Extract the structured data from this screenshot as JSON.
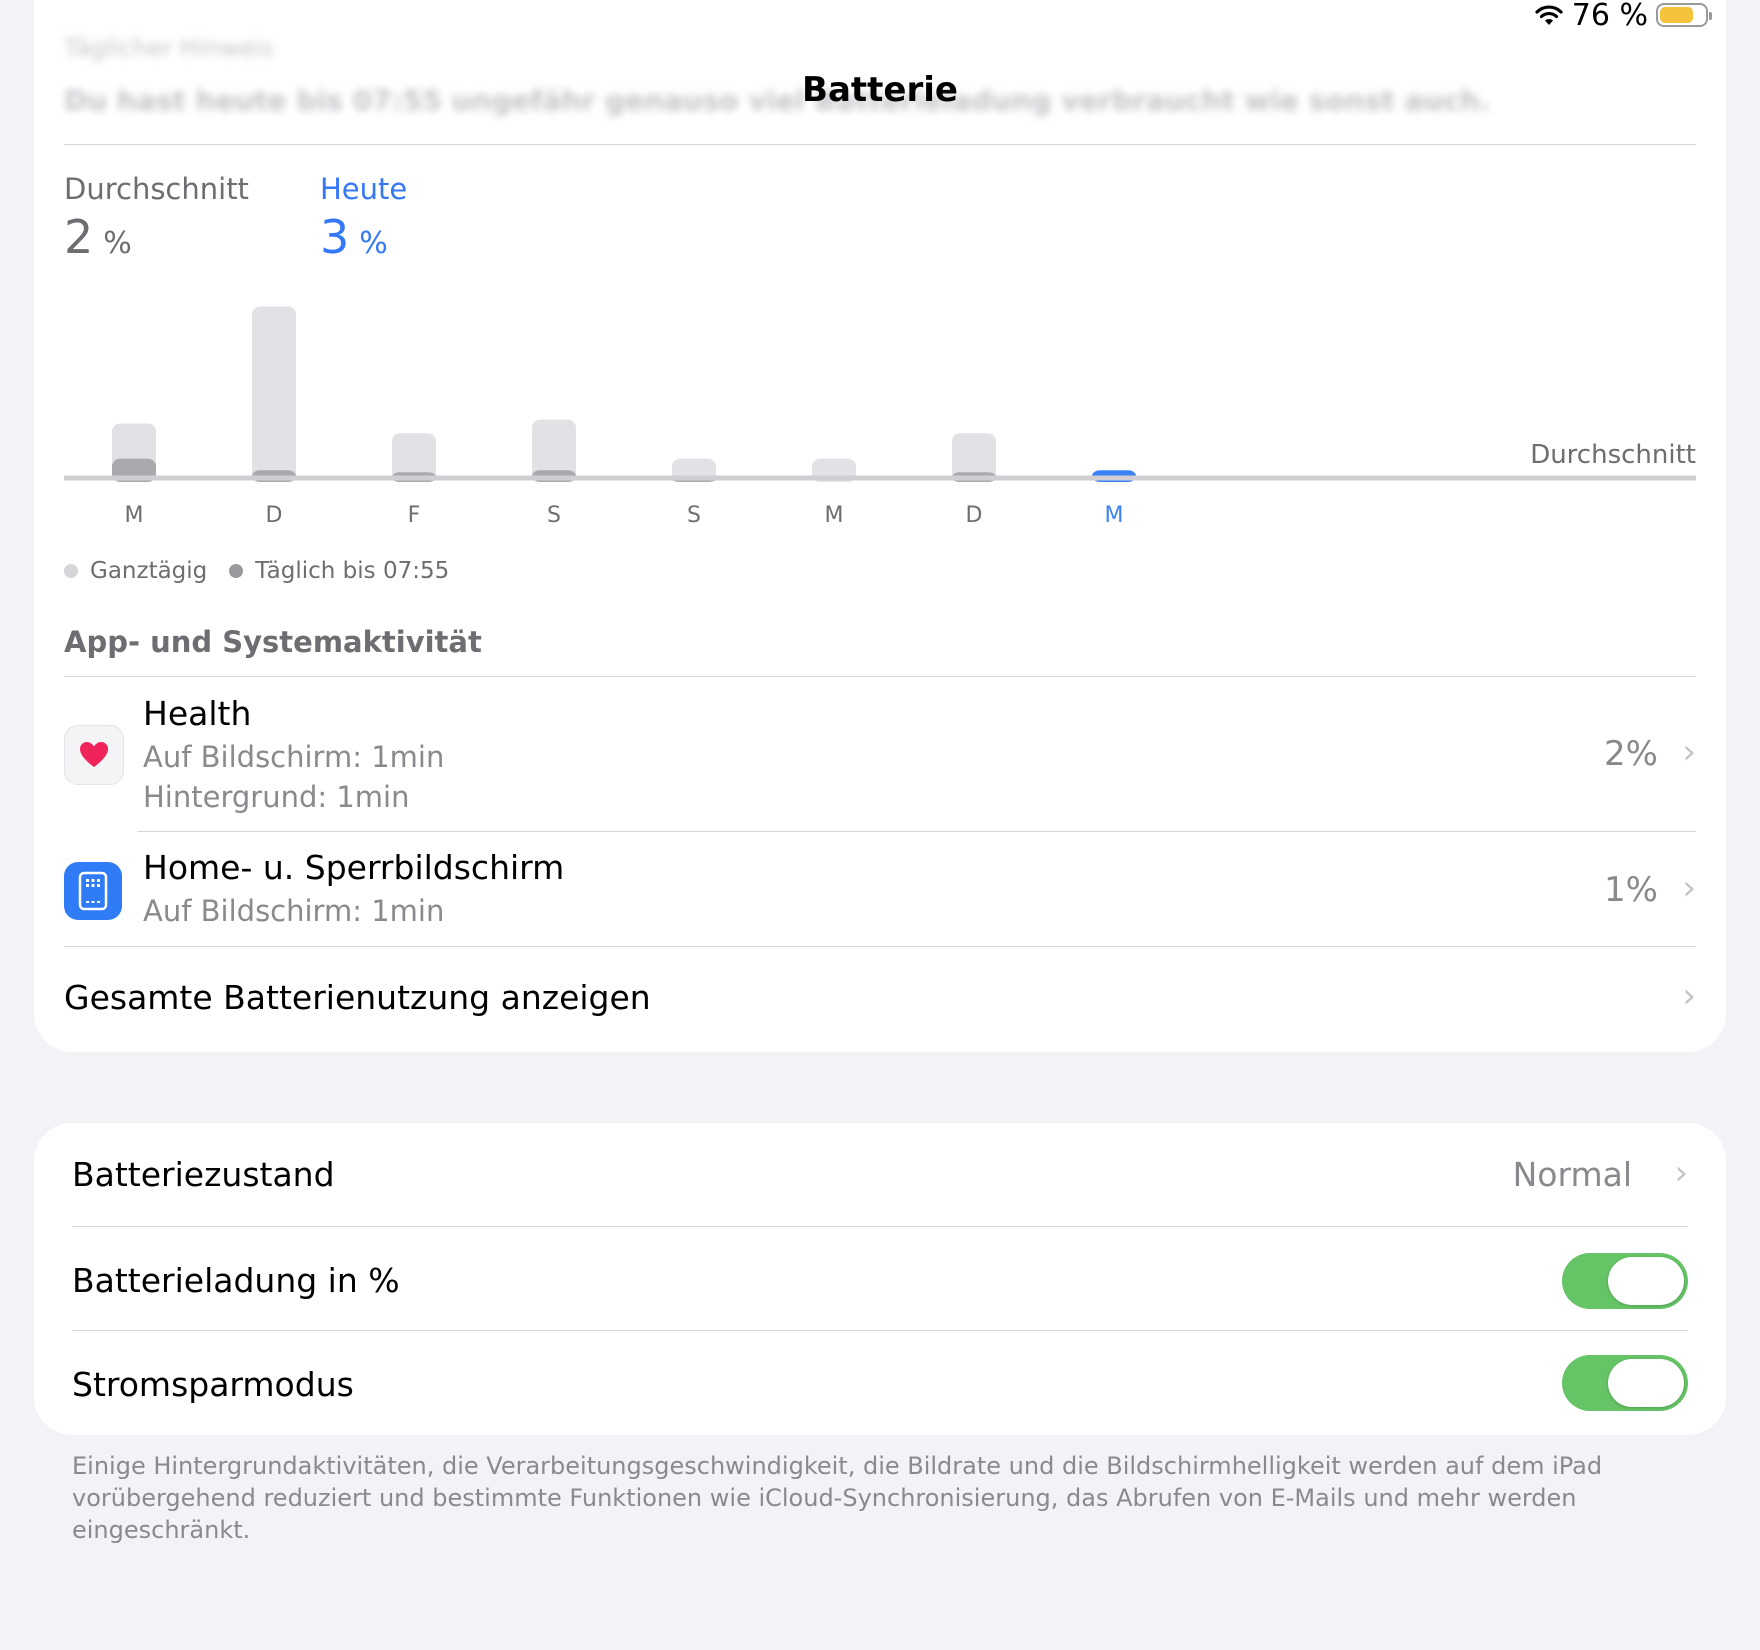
{
  "status": {
    "battery_pct": "76 %",
    "battery_level": 0.76,
    "battery_color": "#f5c23c"
  },
  "nav": {
    "title": "Batterie"
  },
  "blurred": {
    "line1": "Täglicher Hinweis",
    "line2": "Du hast heute bis 07:55 ungefähr genauso viel Batterieladung verbraucht wie sonst auch."
  },
  "stats": {
    "average_label": "Durchschnitt",
    "average_value": "2",
    "average_unit": "%",
    "today_label": "Heute",
    "today_value": "3",
    "today_unit": "%"
  },
  "chart_data": {
    "type": "bar",
    "categories": [
      "M",
      "D",
      "F",
      "S",
      "S",
      "M",
      "D",
      "M"
    ],
    "series": [
      {
        "name": "Ganztägig",
        "values": [
          3,
          9,
          2.5,
          3.2,
          1.2,
          1.2,
          2.5,
          0
        ]
      },
      {
        "name": "Täglich bis 07:55",
        "values": [
          1.2,
          0.6,
          0.5,
          0.6,
          0.3,
          0,
          0.5,
          0.6
        ]
      }
    ],
    "average_line_label": "Durchschnitt",
    "highlight_index": 7,
    "colors": {
      "all_day": "#e2e2e6",
      "until": "#a9a9ae",
      "today": "#3b82f6",
      "axis": "#cfcfd3"
    }
  },
  "legend": {
    "all_day": "Ganztägig",
    "until": "Täglich bis 07:55"
  },
  "activity": {
    "header": "App- und Systemaktivität",
    "apps": [
      {
        "name": "Health",
        "screen": "Auf Bildschirm: 1min",
        "background": "Hintergrund: 1min",
        "percent": "2%",
        "icon": "heart-icon"
      },
      {
        "name": "Home- u. Sperrbildschirm",
        "screen": "Auf Bildschirm: 1min",
        "percent": "1%",
        "icon": "home-screen-icon"
      }
    ],
    "show_all": "Gesamte Batterienutzung anzeigen"
  },
  "settings": {
    "health_label": "Batteriezustand",
    "health_value": "Normal",
    "percent_label": "Batterieladung in %",
    "percent_on": true,
    "lowpower_label": "Stromsparmodus",
    "lowpower_on": true
  },
  "footnote": "Einige Hintergrundaktivitäten, die Verarbeitungsgeschwindigkeit, die Bildrate und die Bildschirmhelligkeit werden auf dem iPad vorübergehend reduziert und bestimmte Funktionen wie iCloud-Synchronisierung, das Abrufen von E-Mails und mehr werden eingeschränkt."
}
